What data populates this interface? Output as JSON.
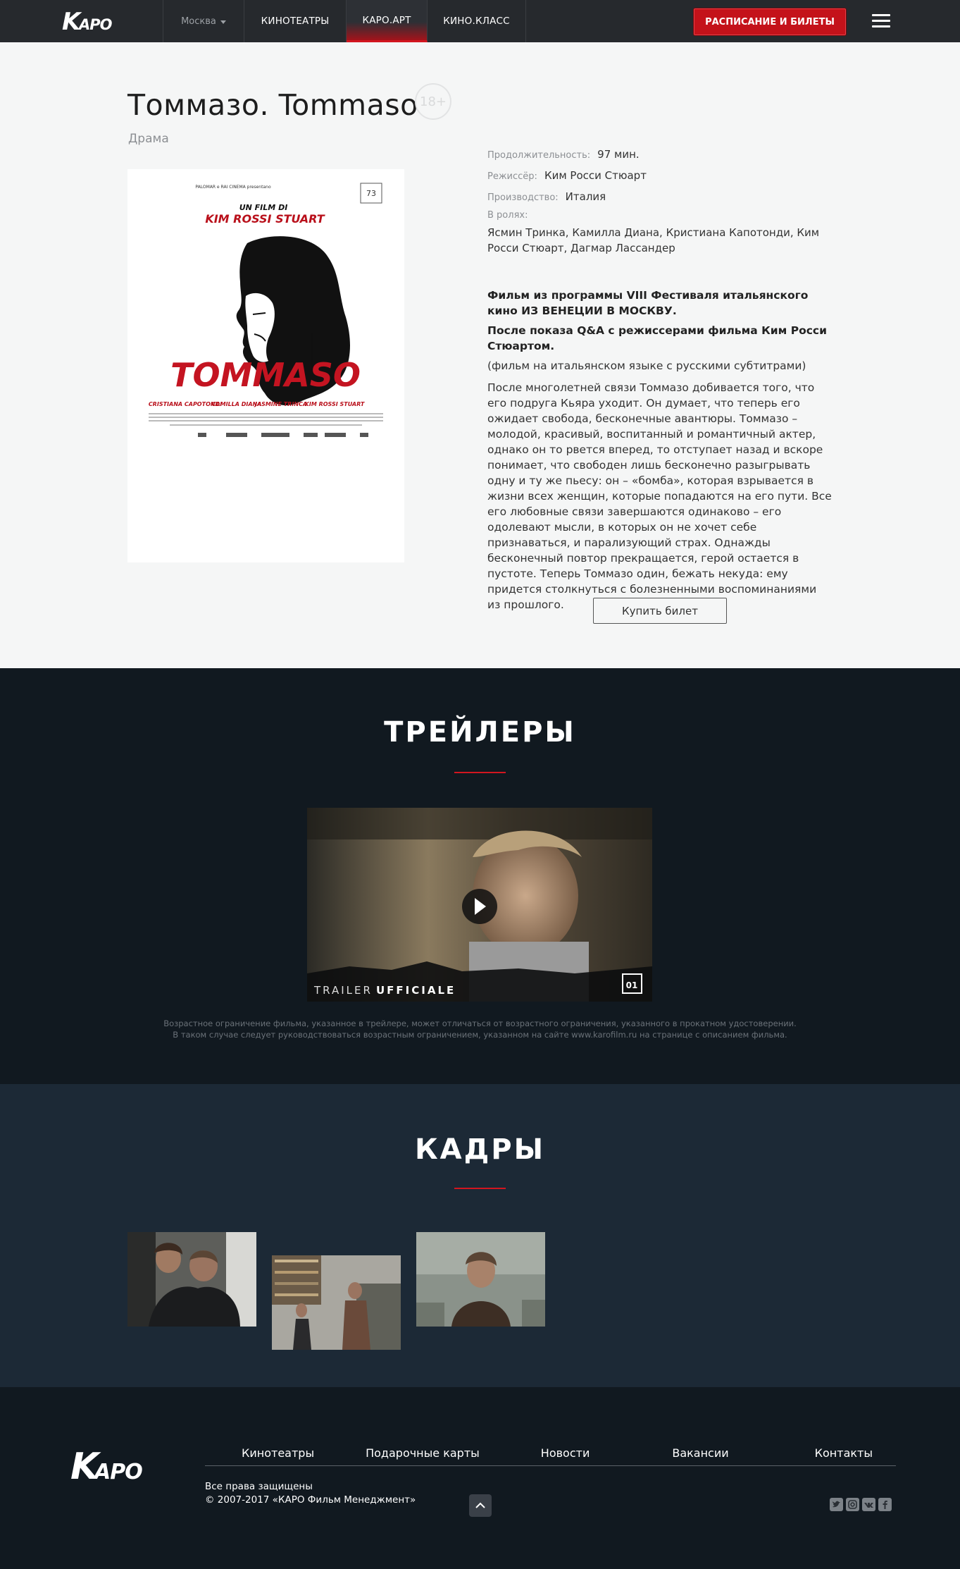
{
  "header": {
    "logo_text": "КАРО",
    "city": "Москва",
    "nav": [
      "КИНОТЕАТРЫ",
      "КАРО.АРТ",
      "КИНО.КЛАСС"
    ],
    "schedule_button": "РАСПИСАНИЕ И БИЛЕТЫ",
    "menu_icon": "hamburger-menu-icon"
  },
  "film": {
    "title": "Томмазо. Tommaso",
    "age_rating": "18+",
    "genre": "Драма",
    "poster": {
      "presenter": "PALOMAR e RAI CINEMA presentano",
      "tagline": "UN FILM DI",
      "director": "KIM ROSSI STUART",
      "title": "TOMMASO",
      "festival_mark": "73",
      "cast": [
        "CRISTIANA CAPOTONDI",
        "CAMILLA DIANA",
        "JASMINE TRINCA",
        "KIM ROSSI STUART"
      ]
    },
    "details": {
      "duration_label": "Продолжительность:",
      "duration_value": "97 мин.",
      "director_label": "Режиссёр:",
      "director_value": "Ким Росси Стюарт",
      "production_label": "Производство:",
      "production_value": "Италия",
      "cast_label": "В ролях:",
      "cast_value": "Ясмин Тринка, Камилла Диана, Кристиана Капотонди, Ким Росси Стюарт, Дагмар Лассандер"
    },
    "description": {
      "bold_1": "Фильм из программы VIII Фестиваля итальянского кино ИЗ ВЕНЕЦИИ В МОСКВУ.",
      "bold_2": "После показа Q&A с режиссерами фильма Ким Росси Стюартом.",
      "note": "(фильм на итальянском языке с русскими субтитрами)",
      "synopsis": "После многолетней связи Томмазо добивается того, что его подруга Кьяра уходит. Он думает, что теперь его ожидает свобода, бесконечные авантюры. Томмазо – молодой, красивый, воспитанный и романтичный актер, однако он то рвется вперед, то отступает назад и вскоре понимает, что свободен лишь бесконечно разыгрывать одну и ту же пьесу: он – «бомба», которая взрывается в жизни всех женщин, которые попадаются на его пути. Все его любовные связи завершаются одинаково – его одолевают мысли, в которых он не хочет себе признаваться, и парализующий страх. Однажды бесконечный повтор прекращается, герой остается в пустоте. Теперь Томмазо один, бежать некуда: ему придется столкнуться с болезненными воспоминаниями из прошлого."
    },
    "buy_button": "Купить билет"
  },
  "trailers": {
    "title": "ТРЕЙЛЕРЫ",
    "video_caption_left": "TRAILER",
    "video_caption_right": "UFFICIALE",
    "video_badge": "01",
    "disclaimer_line1": "Возрастное ограничение фильма, указанное в трейлере, может отличаться от возрастного ограничения, указанного в прокатном удостоверении.",
    "disclaimer_line2": "В таком случае следует руководствоваться возрастным ограничением, указанном на сайте www.karofilm.ru на странице с описанием фильма."
  },
  "stills": {
    "title": "КАДРЫ"
  },
  "footer": {
    "nav": [
      "Кинотеатры",
      "Подарочные карты",
      "Новости",
      "Вакансии",
      "Контакты"
    ],
    "rights": "Все права защищены",
    "copyright": "© 2007-2017 «КАРО Фильм Менеджмент»",
    "social_icons": [
      "twitter-icon",
      "instagram-icon",
      "vk-icon",
      "facebook-icon"
    ]
  },
  "colors": {
    "accent_red": "#c4121a",
    "header_bg": "#26292d",
    "trailers_bg": "#111920",
    "stills_bg": "#1c2936"
  }
}
